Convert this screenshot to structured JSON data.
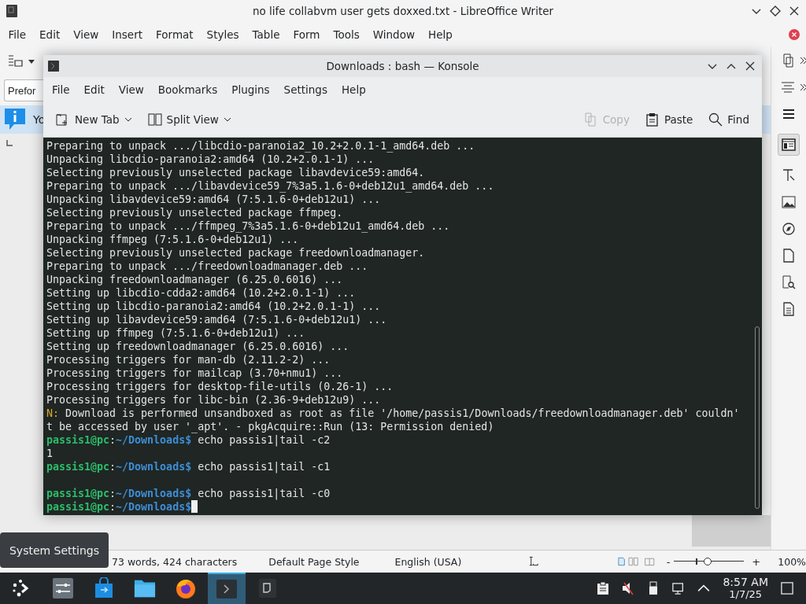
{
  "writer": {
    "title": "no life collabvm user gets doxxed.txt - LibreOffice Writer",
    "menu": [
      "File",
      "Edit",
      "View",
      "Insert",
      "Format",
      "Styles",
      "Table",
      "Form",
      "Tools",
      "Window",
      "Help"
    ],
    "paragraph_style": "Prefor",
    "infobar": "Yo",
    "status": {
      "words": "73 words, 424 characters",
      "page_style": "Default Page Style",
      "language": "English (USA)",
      "zoom_out": "-",
      "zoom_in": "+",
      "zoom": {
        "level": 0.48
      },
      "zoom_percent": "100%"
    }
  },
  "konsole": {
    "title": "Downloads : bash — Konsole",
    "menu": [
      "File",
      "Edit",
      "View",
      "Bookmarks",
      "Plugins",
      "Settings",
      "Help"
    ],
    "toolbar": [
      {
        "kind": "new-tab",
        "label": "New Tab",
        "menu": true,
        "disabled": false
      },
      {
        "kind": "split-view",
        "label": "Split View",
        "menu": true,
        "disabled": false
      },
      {
        "kind": "copy",
        "label": "Copy",
        "menu": false,
        "disabled": true
      },
      {
        "kind": "paste",
        "label": "Paste",
        "menu": false,
        "disabled": false
      },
      {
        "kind": "find",
        "label": "Find",
        "menu": false,
        "disabled": false
      }
    ],
    "lines": [
      {
        "kind": "plain",
        "text": "Preparing to unpack .../libcdio-paranoia2_10.2+2.0.1-1_amd64.deb ..."
      },
      {
        "kind": "plain",
        "text": "Unpacking libcdio-paranoia2:amd64 (10.2+2.0.1-1) ..."
      },
      {
        "kind": "plain",
        "text": "Selecting previously unselected package libavdevice59:amd64."
      },
      {
        "kind": "plain",
        "text": "Preparing to unpack .../libavdevice59_7%3a5.1.6-0+deb12u1_amd64.deb ..."
      },
      {
        "kind": "plain",
        "text": "Unpacking libavdevice59:amd64 (7:5.1.6-0+deb12u1) ..."
      },
      {
        "kind": "plain",
        "text": "Selecting previously unselected package ffmpeg."
      },
      {
        "kind": "plain",
        "text": "Preparing to unpack .../ffmpeg_7%3a5.1.6-0+deb12u1_amd64.deb ..."
      },
      {
        "kind": "plain",
        "text": "Unpacking ffmpeg (7:5.1.6-0+deb12u1) ..."
      },
      {
        "kind": "plain",
        "text": "Selecting previously unselected package freedownloadmanager."
      },
      {
        "kind": "plain",
        "text": "Preparing to unpack .../freedownloadmanager.deb ..."
      },
      {
        "kind": "plain",
        "text": "Unpacking freedownloadmanager (6.25.0.6016) ..."
      },
      {
        "kind": "plain",
        "text": "Setting up libcdio-cdda2:amd64 (10.2+2.0.1-1) ..."
      },
      {
        "kind": "plain",
        "text": "Setting up libcdio-paranoia2:amd64 (10.2+2.0.1-1) ..."
      },
      {
        "kind": "plain",
        "text": "Setting up libavdevice59:amd64 (7:5.1.6-0+deb12u1) ..."
      },
      {
        "kind": "plain",
        "text": "Setting up ffmpeg (7:5.1.6-0+deb12u1) ..."
      },
      {
        "kind": "plain",
        "text": "Setting up freedownloadmanager (6.25.0.6016) ..."
      },
      {
        "kind": "plain",
        "text": "Processing triggers for man-db (2.11.2-2) ..."
      },
      {
        "kind": "plain",
        "text": "Processing triggers for mailcap (3.70+nmu1) ..."
      },
      {
        "kind": "plain",
        "text": "Processing triggers for desktop-file-utils (0.26-1) ..."
      },
      {
        "kind": "plain",
        "text": "Processing triggers for libc-bin (2.36-9+deb12u9) ..."
      },
      {
        "kind": "notice",
        "prefix": "N:",
        "text": " Download is performed unsandboxed as root as file '/home/passis1/Downloads/freedownloadmanager.deb' couldn'"
      },
      {
        "kind": "plain",
        "text": "t be accessed by user '_apt'. - pkgAcquire::Run (13: Permission denied)"
      },
      {
        "kind": "prompt",
        "user": "passis1@pc",
        "sep": ":",
        "path": "~/Downloads$",
        "command": " echo passis1|tail -c2",
        "cursor": false
      },
      {
        "kind": "plain",
        "text": "1"
      },
      {
        "kind": "prompt",
        "user": "passis1@pc",
        "sep": ":",
        "path": "~/Downloads$",
        "command": " echo passis1|tail -c1",
        "cursor": false
      },
      {
        "kind": "blank"
      },
      {
        "kind": "prompt",
        "user": "passis1@pc",
        "sep": ":",
        "path": "~/Downloads$",
        "command": " echo passis1|tail -c0",
        "cursor": false
      },
      {
        "kind": "prompt",
        "user": "passis1@pc",
        "sep": ":",
        "path": "~/Downloads$",
        "cursor": true
      }
    ]
  },
  "tooltip": "System Settings",
  "taskbar": {
    "apps": [
      {
        "kind": "launcher",
        "selected": false
      },
      {
        "kind": "settings",
        "selected": false
      },
      {
        "kind": "store",
        "selected": false
      },
      {
        "kind": "files",
        "selected": false
      },
      {
        "kind": "browser",
        "selected": false
      },
      {
        "kind": "terminal",
        "selected": true
      },
      {
        "kind": "document",
        "selected": false
      }
    ],
    "clock": {
      "time": "8:57 AM",
      "date": "1/7/25"
    }
  }
}
